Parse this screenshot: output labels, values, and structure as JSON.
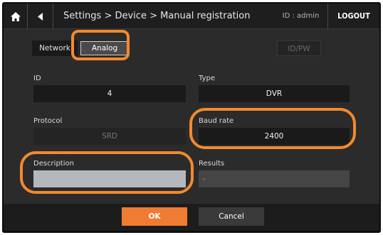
{
  "topbar": {
    "home_icon": "home-icon",
    "back_icon": "back-icon",
    "breadcrumb": "Settings > Device > Manual registration",
    "user_id": "ID : admin",
    "logout_label": "LOGOUT"
  },
  "tabs": {
    "network": "Network",
    "analog": "Analog",
    "idpw": "ID/PW"
  },
  "form": {
    "id_label": "ID",
    "id_value": "4",
    "type_label": "Type",
    "type_value": "DVR",
    "protocol_label": "Protocol",
    "protocol_value": "SRD",
    "baud_label": "Baud rate",
    "baud_value": "2400",
    "description_label": "Description",
    "description_value": "",
    "results_label": "Results",
    "results_value": "-"
  },
  "footer": {
    "ok_label": "OK",
    "cancel_label": "Cancel"
  },
  "colors": {
    "accent": "#f07b32",
    "highlight": "#f38a2d",
    "background": "#2b2b2b"
  }
}
